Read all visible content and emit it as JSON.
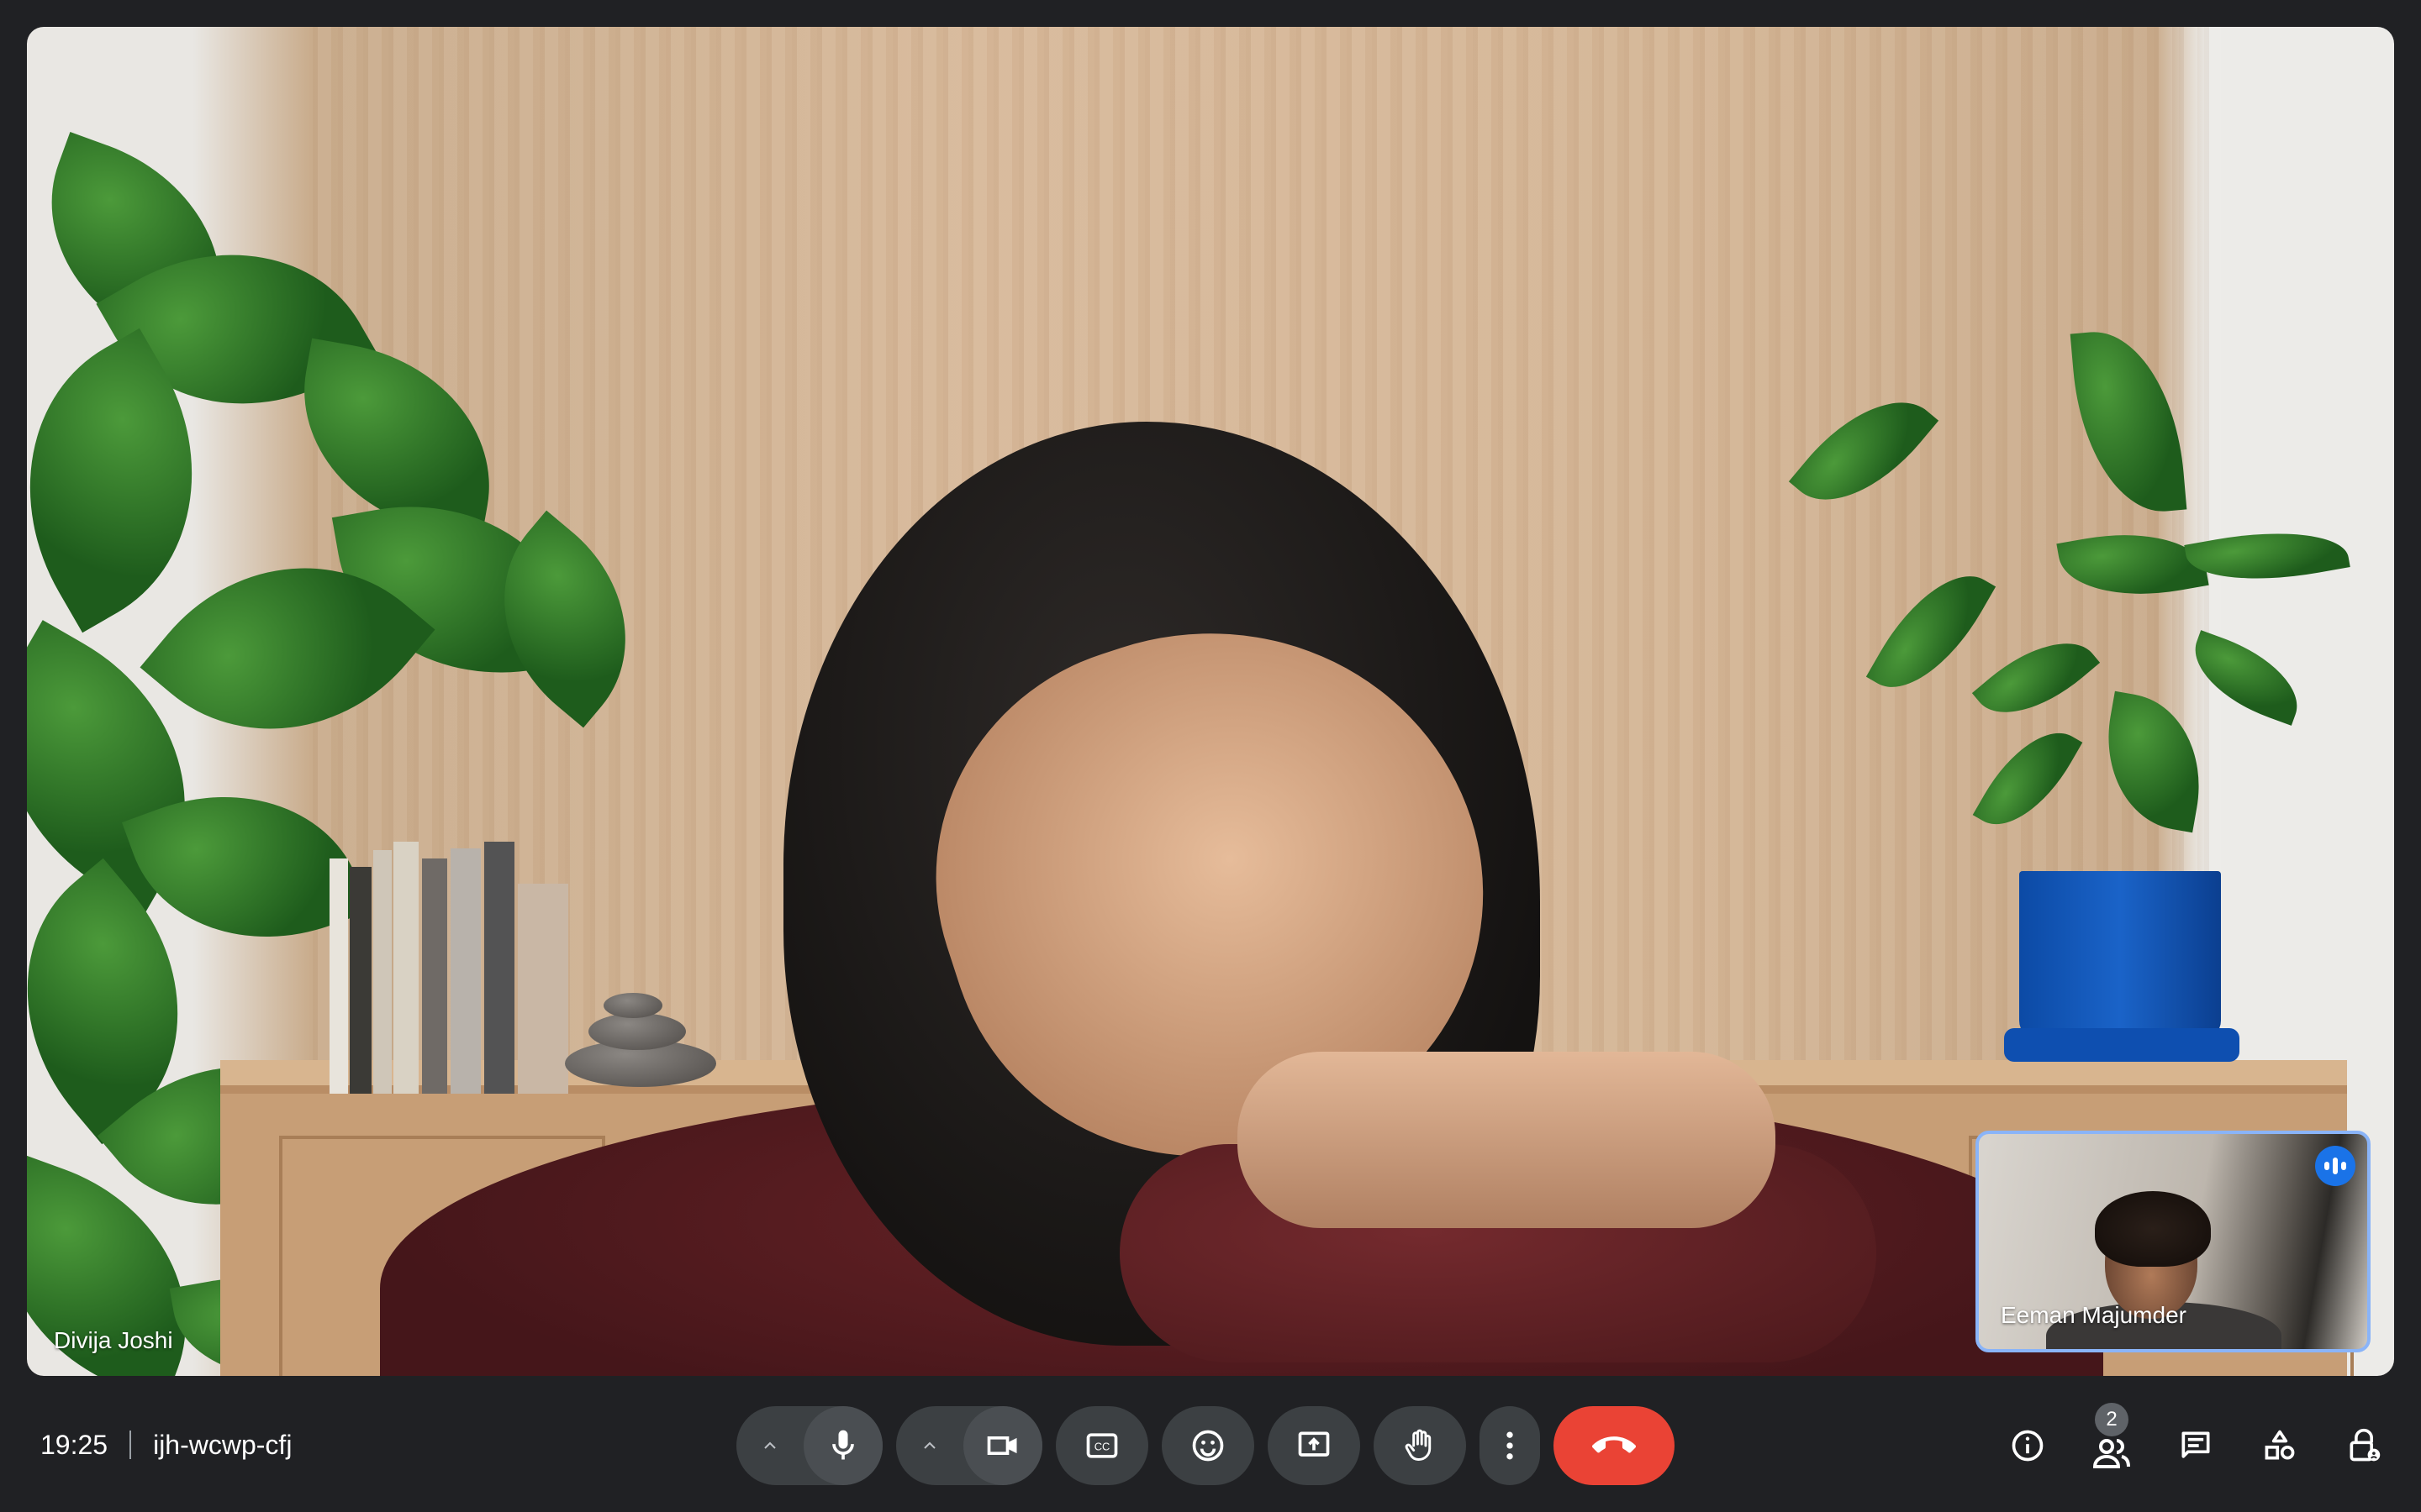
{
  "meeting": {
    "time": "19:25",
    "code": "ijh-wcwp-cfj"
  },
  "participants": {
    "main_name": "Divija Joshi",
    "self_name": "Eeman Majumder",
    "count": "2"
  },
  "icons": {
    "mic": "microphone-icon",
    "camera": "video-camera-icon",
    "captions": "closed-captions-icon",
    "emoji": "emoji-icon",
    "present": "present-screen-icon",
    "hand": "raise-hand-icon",
    "more": "more-options-icon",
    "end_call": "end-call-icon",
    "info": "info-icon",
    "people": "people-icon",
    "chat": "chat-icon",
    "activities": "activities-icon",
    "host_controls": "host-controls-icon"
  },
  "colors": {
    "background": "#202124",
    "button": "#3c4043",
    "end_call": "#ea4335",
    "speaking": "#1a73e8",
    "self_border": "#8ab4f8"
  }
}
